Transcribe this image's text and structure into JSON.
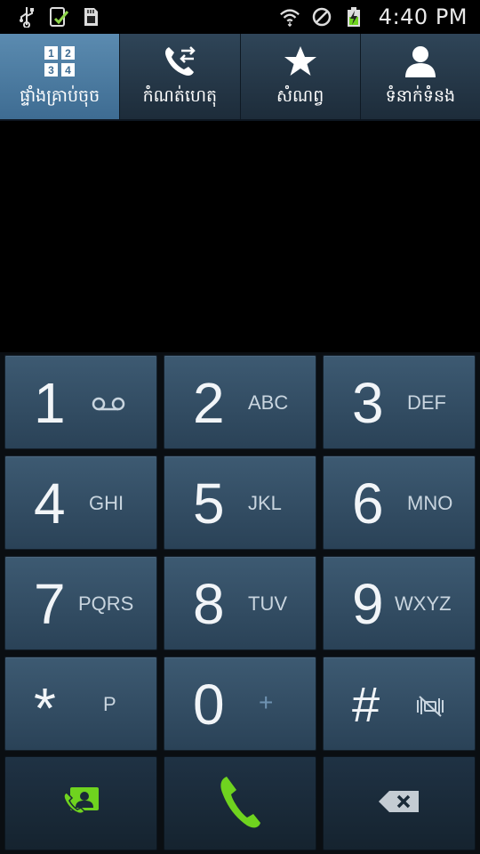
{
  "status_bar": {
    "time": "4:40 PM",
    "icons": [
      "usb-icon",
      "download-check-icon",
      "sd-card-icon",
      "wifi-icon",
      "blocked-icon",
      "battery-charging-icon"
    ]
  },
  "tabs": [
    {
      "label": "ផ្ទាំងគ្រាប់ចុច",
      "icon": "keypad-icon",
      "active": true
    },
    {
      "label": "កំណត់ហេតុ",
      "icon": "call-log-icon",
      "active": false
    },
    {
      "label": "សំណព្វ",
      "icon": "star-icon",
      "active": false
    },
    {
      "label": "ទំនាក់ទំនង",
      "icon": "contact-icon",
      "active": false
    }
  ],
  "keypad": {
    "keys": [
      {
        "digit": "1",
        "letters": ""
      },
      {
        "digit": "2",
        "letters": "ABC"
      },
      {
        "digit": "3",
        "letters": "DEF"
      },
      {
        "digit": "4",
        "letters": "GHI"
      },
      {
        "digit": "5",
        "letters": "JKL"
      },
      {
        "digit": "6",
        "letters": "MNO"
      },
      {
        "digit": "7",
        "letters": "PQRS"
      },
      {
        "digit": "8",
        "letters": "TUV"
      },
      {
        "digit": "9",
        "letters": "WXYZ"
      },
      {
        "digit": "*",
        "letters": "P"
      },
      {
        "digit": "0",
        "letters": "+"
      },
      {
        "digit": "#",
        "letters": ""
      }
    ]
  },
  "colors": {
    "accent_green": "#6fd31f",
    "active_tab": "#4a7aa1",
    "key_face": "#34506a"
  }
}
